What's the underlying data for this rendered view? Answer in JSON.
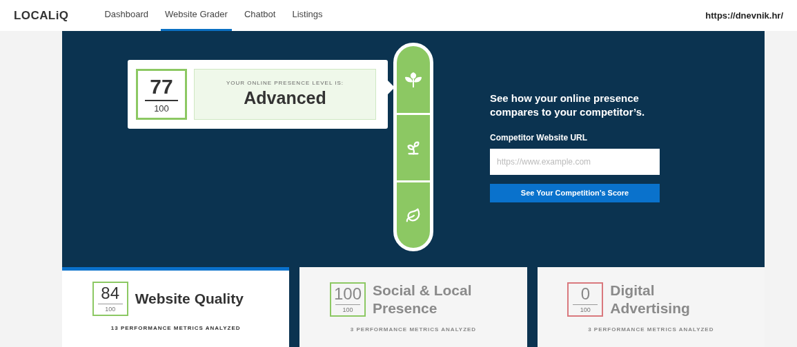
{
  "brand": "LOCALiQ",
  "nav": [
    {
      "label": "Dashboard",
      "selected": false
    },
    {
      "label": "Website Grader",
      "selected": true
    },
    {
      "label": "Chatbot",
      "selected": false
    },
    {
      "label": "Listings",
      "selected": false
    }
  ],
  "site_url": "https://dnevnik.hr/",
  "result": {
    "score": "77",
    "out_of": "100",
    "caption": "YOUR ONLINE PRESENCE LEVEL IS:",
    "level_name": "Advanced"
  },
  "levels": [
    {
      "kind": "plant"
    },
    {
      "kind": "sprout"
    },
    {
      "kind": "seedling"
    }
  ],
  "compare": {
    "heading": "See how your online presence compares to your competitor’s.",
    "field_label": "Competitor Website URL",
    "placeholder": "https://www.example.com",
    "button": "See Your Competition’s Score"
  },
  "cards": [
    {
      "score": "84",
      "out_of": "100",
      "title": "Website Quality",
      "metrics": "13 PERFORMANCE METRICS ANALYZED",
      "selected": true,
      "color": "#8cc863"
    },
    {
      "score": "100",
      "out_of": "100",
      "title": "Social & Local Presence",
      "metrics": "3 PERFORMANCE METRICS ANALYZED",
      "selected": false,
      "color": "#8cc863"
    },
    {
      "score": "0",
      "out_of": "100",
      "title": "Digital Advertising",
      "metrics": "3 PERFORMANCE METRICS ANALYZED",
      "selected": false,
      "color": "#d9787d"
    }
  ]
}
